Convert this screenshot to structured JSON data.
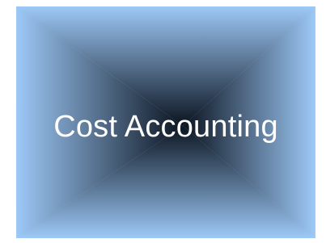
{
  "title": "Cost Accounting",
  "colors": {
    "outer": "#9ec9f7",
    "center": "#0b1420",
    "text": "#ffffff",
    "background": "#ffffff"
  }
}
